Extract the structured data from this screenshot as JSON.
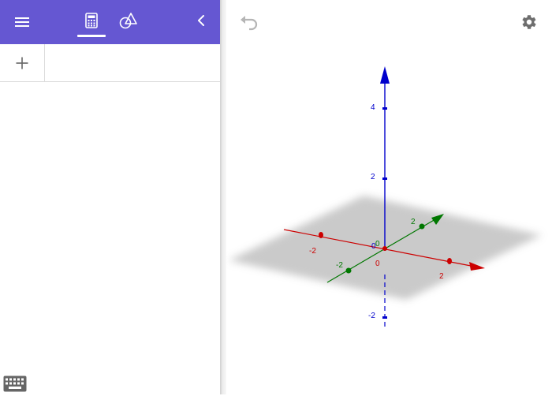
{
  "toolbar": {
    "menu_icon": "hamburger-menu-icon",
    "tabs": [
      {
        "name": "algebra",
        "icon": "calculator-icon",
        "active": true
      },
      {
        "name": "tools",
        "icon": "shapes-icon",
        "active": false
      }
    ],
    "collapse_icon": "chevron-left-icon",
    "color": "#6557d2"
  },
  "algebra": {
    "add_icon": "plus-icon",
    "add_label": "+",
    "input_value": ""
  },
  "keyboard": {
    "icon": "keyboard-icon"
  },
  "graphics": {
    "undo_icon": "undo-icon",
    "settings_icon": "gear-icon",
    "axes": {
      "x": {
        "color": "#cc0000",
        "ticks": [
          "-2",
          "2"
        ]
      },
      "y": {
        "color": "#006600",
        "ticks": [
          "-2",
          "2"
        ]
      },
      "z": {
        "color": "#0000cc",
        "ticks": [
          "4",
          "2",
          "-2"
        ]
      }
    },
    "origin_labels": [
      "0",
      "0",
      "0"
    ],
    "plane_color": "#bdbdbd"
  }
}
